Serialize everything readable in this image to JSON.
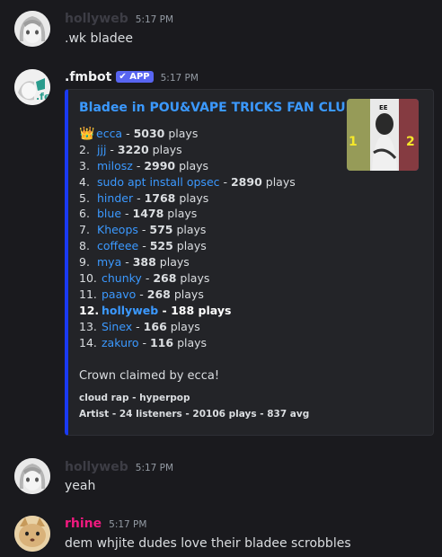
{
  "messages": [
    {
      "author": "hollyweb",
      "time": "5:17 PM",
      "text": ".wk bladee"
    },
    {
      "author": ".fmbot",
      "badge": "APP",
      "time": "5:17 PM"
    },
    {
      "author": "hollyweb",
      "time": "5:17 PM",
      "text": "yeah"
    },
    {
      "author": "rhine",
      "time": "5:17 PM",
      "text": "dem whjite dudes love their bladee scrobbles"
    }
  ],
  "embed": {
    "title": "Bladee in POU&VAPE TRICKS FAN CLUB",
    "rows": [
      {
        "rank": "👑",
        "user": "ecca",
        "plays": "5030",
        "suffix": "plays"
      },
      {
        "rank": "2.",
        "user": "jjj",
        "plays": "3220",
        "suffix": "plays"
      },
      {
        "rank": "3.",
        "user": "milosz",
        "plays": "2990",
        "suffix": "plays"
      },
      {
        "rank": "4.",
        "user": "sudo apt install opsec",
        "plays": "2890",
        "suffix": "plays"
      },
      {
        "rank": "5.",
        "user": "hinder",
        "plays": "1768",
        "suffix": "plays"
      },
      {
        "rank": "6.",
        "user": "blue",
        "plays": "1478",
        "suffix": "plays"
      },
      {
        "rank": "7.",
        "user": "Kheops",
        "plays": "575",
        "suffix": "plays"
      },
      {
        "rank": "8.",
        "user": "coffeee",
        "plays": "525",
        "suffix": "plays"
      },
      {
        "rank": "9.",
        "user": "mya",
        "plays": "388",
        "suffix": "plays"
      },
      {
        "rank": "10.",
        "user": "chunky",
        "plays": "268",
        "suffix": "plays"
      },
      {
        "rank": "11.",
        "user": "paavo",
        "plays": "268",
        "suffix": "plays"
      },
      {
        "rank": "12.",
        "user": "hollyweb",
        "plays": "188",
        "suffix": "plays",
        "highlight": true
      },
      {
        "rank": "13.",
        "user": "Sinex",
        "plays": "166",
        "suffix": "plays"
      },
      {
        "rank": "14.",
        "user": "zakuro",
        "plays": "116",
        "suffix": "plays"
      }
    ],
    "crown_text": "Crown claimed by ecca!",
    "tags": "cloud rap - hyperpop",
    "stats": "Artist - 24 listeners - 20106 plays - 837 avg",
    "thumb_text": "EE"
  },
  "colors": {
    "hollyweb_name": "#3d3d45",
    "fmbot_name": "#f2f3f5",
    "rhine_name": "#f0197f",
    "link": "#3b99ff",
    "embed_border": "#1a3af1"
  }
}
